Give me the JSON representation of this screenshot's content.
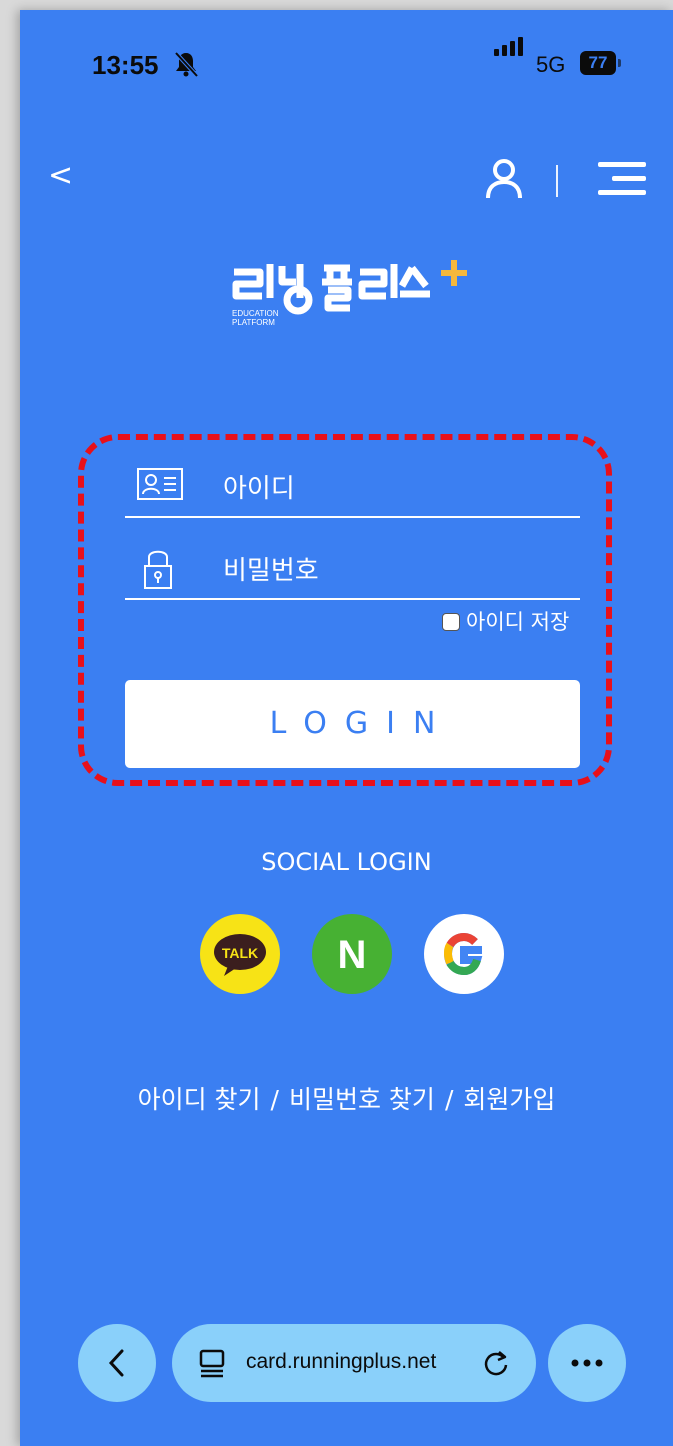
{
  "status": {
    "time": "13:55",
    "network": "5G",
    "battery": "77"
  },
  "header": {
    "back_label": "<"
  },
  "logo": {
    "subtitle_line1": "EDUCATION",
    "subtitle_line2": "PLATFORM"
  },
  "login": {
    "id_placeholder": "아이디",
    "pw_placeholder": "비밀번호",
    "save_id_label": "아이디 저장",
    "login_button": "LOGIN"
  },
  "social": {
    "title": "SOCIAL LOGIN",
    "kakao_label": "TALK",
    "naver_label": "N"
  },
  "links": {
    "find_id": "아이디 찾기",
    "sep": "/",
    "find_pw": "비밀번호 찾기",
    "signup": "회원가입"
  },
  "browser": {
    "url": "card.runningplus.net"
  },
  "colors": {
    "background": "#3b7ff2",
    "highlight_border": "#e8101a",
    "browser_button": "#8ad0fa"
  },
  "icons": [
    "bell-muted-icon",
    "signal-icon",
    "battery-icon",
    "back-icon",
    "user-icon",
    "menu-icon",
    "id-card-icon",
    "lock-icon",
    "kakao-icon",
    "naver-icon",
    "google-icon",
    "tabs-icon",
    "reload-icon",
    "more-icon"
  ]
}
